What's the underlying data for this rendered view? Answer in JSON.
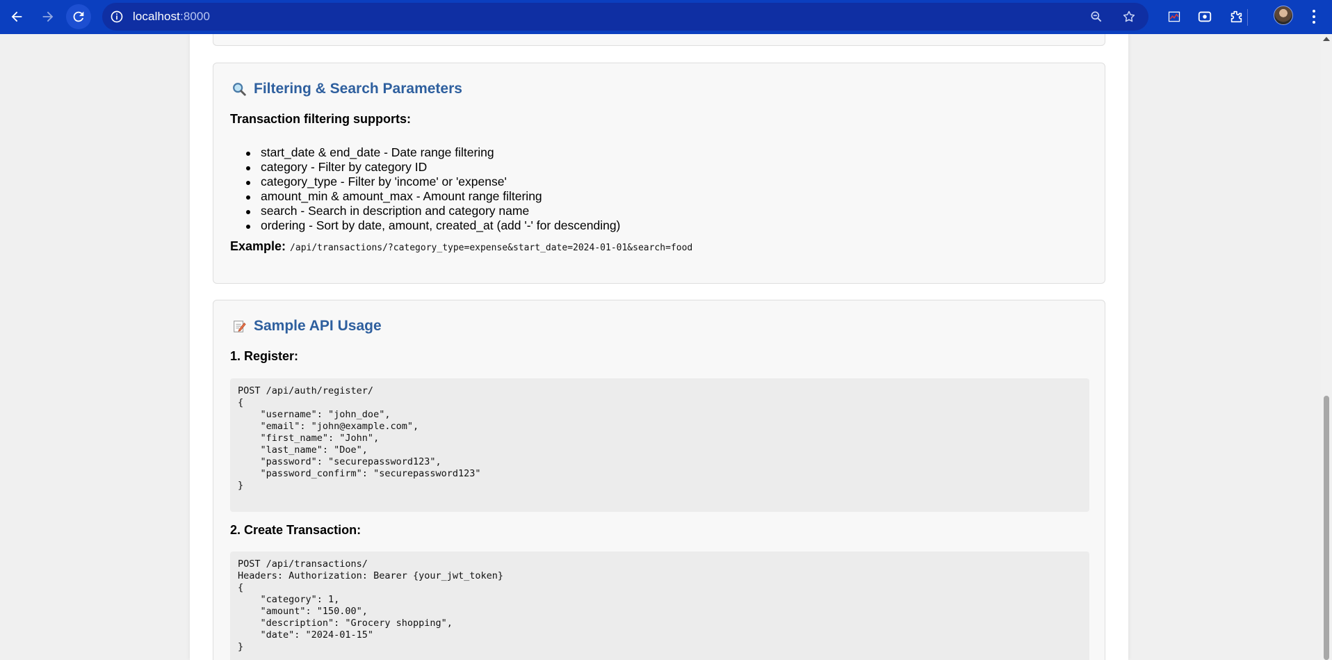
{
  "browser": {
    "url_host": "localhost",
    "url_port": ":8000"
  },
  "filter_section": {
    "icon": "magnifier-icon",
    "title": "Filtering & Search Parameters",
    "intro": "Transaction filtering supports:",
    "items": [
      "start_date & end_date - Date range filtering",
      "category - Filter by category ID",
      "category_type - Filter by 'income' or 'expense'",
      "amount_min & amount_max - Amount range filtering",
      "search - Search in description and category name",
      "ordering - Sort by date, amount, created_at (add '-' for descending)"
    ],
    "example_label": "Example:",
    "example_code": "/api/transactions/?category_type=expense&start_date=2024-01-01&search=food"
  },
  "sample_section": {
    "icon": "memo-icon",
    "title": "Sample API Usage",
    "register_heading": "1. Register:",
    "register_code": [
      "POST /api/auth/register/",
      "{",
      "    \"username\": \"john_doe\",",
      "    \"email\": \"john@example.com\",",
      "    \"first_name\": \"John\",",
      "    \"last_name\": \"Doe\",",
      "    \"password\": \"securepassword123\",",
      "    \"password_confirm\": \"securepassword123\"",
      "}"
    ],
    "create_heading": "2. Create Transaction:",
    "create_code": [
      "POST /api/transactions/",
      "Headers: Authorization: Bearer {your_jwt_token}",
      "{",
      "    \"category\": 1,",
      "    \"amount\": \"150.00\",",
      "    \"description\": \"Grocery shopping\",",
      "    \"date\": \"2024-01-15\"",
      "}"
    ]
  },
  "colors": {
    "browser_bar": "#0b3fbf",
    "section_title": "#2e5f9e"
  }
}
